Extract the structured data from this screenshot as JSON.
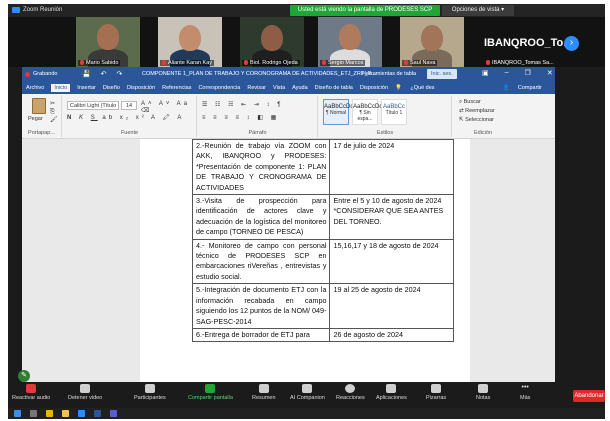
{
  "zoom": {
    "window_title": "Zoom Reunión",
    "share_banner": "Usted está viendo la pantalla de PRODESES SCP",
    "view_options": "Opciones de vista",
    "participants": [
      {
        "name": "Mario Sabido"
      },
      {
        "name": "Aliante Karan Kay"
      },
      {
        "name": "Biol. Rodrigo Ojeda"
      },
      {
        "name": "Sergio Marcos"
      },
      {
        "name": "Saul Nava"
      },
      {
        "name": "IBANQROO_Tomas Sa..."
      }
    ],
    "spotlight_name": "IBANQROO_To...",
    "controls": [
      {
        "label": "Reactivar audio"
      },
      {
        "label": "Detener video"
      },
      {
        "label": "Participantes",
        "count": "8"
      },
      {
        "label": "Compartir pantalla"
      },
      {
        "label": "Resumen"
      },
      {
        "label": "AI Companion"
      },
      {
        "label": "Reacciones"
      },
      {
        "label": "Aplicaciones"
      },
      {
        "label": "Pizarras"
      },
      {
        "label": "Notas"
      },
      {
        "label": "Más"
      }
    ],
    "leave_label": "Abandonar",
    "colors": {
      "share_green": "#1fa637",
      "zoom_blue": "#2d8cff",
      "leave_red": "#e02828"
    }
  },
  "word": {
    "recording_label": "Grabando",
    "quick_access": "💾 ↶ ↷",
    "doc_title": "COMPONENTE 1_PLAN DE TRABAJO Y CORONOGRAMA DE ACTIVIDADES_ETJ_ZRP_R...",
    "table_tools": "Herramientas de tabla",
    "sign_in": "Inic. ses.",
    "tabs": [
      "Archivo",
      "Inicio",
      "Insertar",
      "Diseño",
      "Disposición",
      "Referencias",
      "Correspondencia",
      "Revisar",
      "Vista",
      "Ayuda",
      "Diseño de tabla",
      "Disposición"
    ],
    "active_tab": "Inicio",
    "tell_me": "¿Qué des",
    "share_label": "Compartir",
    "ribbon": {
      "paste_label": "Pegar",
      "clipboard_label": "Portapap...",
      "font_name": "Calibri Light (Título",
      "font_size": "14",
      "font_label": "Fuente",
      "paragraph_label": "Párrafo",
      "styles_label": "Estilos",
      "edit_label": "Edición",
      "styles": [
        {
          "sample": "AaBbCcDc",
          "name": "¶ Normal"
        },
        {
          "sample": "AaBbCcDc",
          "name": "¶ Sin espa..."
        },
        {
          "sample": "AaBbCc",
          "name": "Título 1"
        }
      ],
      "edit_items": [
        "Buscar",
        "Reemplazar",
        "Seleccionar"
      ]
    },
    "rows": [
      {
        "activity": "2.-Reunión de trabajo vía ZOOM con AKK, IBANQROO y PRODESES: *Presentación de componente 1: PLAN DE TRABAJO Y CRONOGRAMA DE ACTIVIDADES",
        "date": "17 de julio de 2024"
      },
      {
        "activity": "3.-Visita de prospección para identificación de actores clave y adecuación de la logística del monitoreo de campo (TORNEO DE PESCA)",
        "date": "Entre el 5 y 10 de agosto de 2024 *CONSIDERAR QUE SEA ANTES DEL TORNEO."
      },
      {
        "activity": "4.- Monitoreo de campo con personal técnico de PRODESES SCP en embarcaciones riVereñas , entrevistas y estudio social.",
        "date": "15,16,17 y 18 de agosto de 2024"
      },
      {
        "activity": "5.-Integración de documento ETJ con la información recabada en campo siguiendo los 12 puntos de la NOM/ 049-SAG-PESC-2014",
        "date": "19 al 25 de agosto de 2024"
      },
      {
        "activity": "6.-Entrega de borrador de ETJ para",
        "date": "26 de agosto de 2024"
      }
    ]
  }
}
